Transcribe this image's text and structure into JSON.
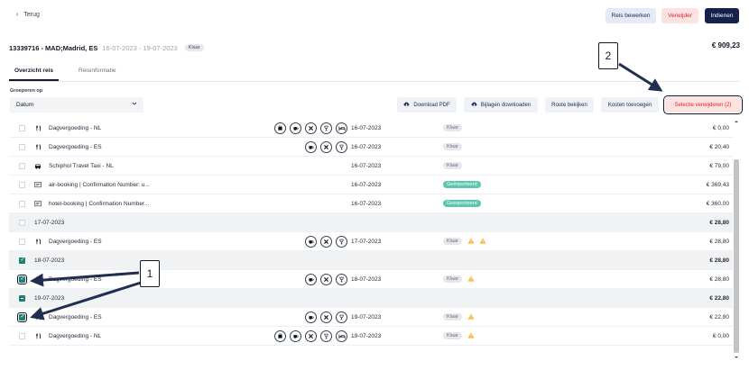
{
  "header": {
    "back_label": "Terug",
    "edit_label": "Reis bewerken",
    "delete_label": "Verwijder",
    "submit_label": "Indienen"
  },
  "trip": {
    "title": "13339716 - MAD;Madrid, ES",
    "dates": "16-07-2023 - 19-07-2023",
    "status": "Klaar",
    "total": "€ 909,23"
  },
  "tabs": [
    {
      "label": "Overzicht reis",
      "active": true
    },
    {
      "label": "Reisinformatie",
      "active": false
    }
  ],
  "grouping": {
    "label": "Groeperen op",
    "selected": "Datum"
  },
  "toolbar": {
    "download_pdf": "Download PDF",
    "download_attachments": "Bijlagen downloaden",
    "view_route": "Route bekijken",
    "add_cost": "Kosten toevoegen",
    "remove_selection": "Selectie verwijderen (2)"
  },
  "rows": [
    {
      "kind": "item",
      "icon": "cutlery-icon",
      "desc": "Dagvergoeding - NL",
      "actions": [
        "receipt-icon",
        "coffee-icon",
        "close-icon",
        "wine-icon",
        "bed-icon"
      ],
      "date": "16-07-2023",
      "status": "Klaar",
      "amount": "€ 0,00"
    },
    {
      "kind": "item",
      "icon": "cutlery-icon",
      "desc": "Dagvergoeding - ES",
      "actions": [
        "coffee-icon",
        "close-icon",
        "wine-icon"
      ],
      "date": "16-07-2023",
      "status": "Klaar",
      "amount": "€ 20,40"
    },
    {
      "kind": "item",
      "icon": "car-icon",
      "desc": "Schiphol Travel Taxi - NL",
      "actions": [],
      "date": "16-07-2023",
      "status": "Klaar",
      "amount": "€ 79,00"
    },
    {
      "kind": "item",
      "icon": "booking-icon",
      "desc": "air-booking | Confirmation Number: u...",
      "actions": [],
      "date": "16-07-2023",
      "status": "Geëxporteerd",
      "amount": "€ 369,43"
    },
    {
      "kind": "item",
      "icon": "booking-icon",
      "desc": "hotel-booking | Confirmation Number...",
      "actions": [],
      "date": "16-07-2023",
      "status": "Geëxporteerd",
      "amount": "€ 360,00"
    },
    {
      "kind": "group",
      "date": "17-07-2023",
      "amount": "€ 28,80"
    },
    {
      "kind": "item",
      "icon": "cutlery-icon",
      "desc": "Dagvergoeding - ES",
      "actions": [
        "coffee-icon",
        "close-icon",
        "wine-icon"
      ],
      "date": "17-07-2023",
      "status": "Klaar",
      "warnings": 2,
      "amount": "€ 28,80"
    },
    {
      "kind": "group",
      "date": "18-07-2023",
      "amount": "€ 28,80",
      "checked": true
    },
    {
      "kind": "item",
      "icon": "cutlery-icon",
      "desc": "Dagvergoeding - ES",
      "actions": [
        "coffee-icon",
        "close-icon",
        "wine-icon"
      ],
      "date": "18-07-2023",
      "status": "Klaar",
      "warnings": 1,
      "amount": "€ 28,80",
      "checked": true
    },
    {
      "kind": "group",
      "date": "19-07-2023",
      "amount": "€ 22,80",
      "partial": true
    },
    {
      "kind": "item",
      "icon": "cutlery-icon",
      "desc": "Dagvergoeding - ES",
      "actions": [
        "coffee-icon",
        "close-icon",
        "wine-icon"
      ],
      "date": "19-07-2023",
      "status": "Klaar",
      "warnings": 1,
      "amount": "€ 22,80",
      "checked": true
    },
    {
      "kind": "item",
      "icon": "cutlery-icon",
      "desc": "Dagvergoeding - NL",
      "actions": [
        "receipt-icon",
        "coffee-icon",
        "close-icon",
        "wine-icon",
        "bed-icon"
      ],
      "date": "19-07-2023",
      "status": "Klaar",
      "warnings": 1,
      "amount": "€ 0,00"
    }
  ],
  "callouts": {
    "one": "1",
    "two": "2"
  },
  "colors": {
    "primary": "#14224d",
    "danger": "#dc2626",
    "danger_bg": "#fde2e2",
    "check": "#1f7f73",
    "exported": "#5cc6b0",
    "warning": "#f5b73b"
  }
}
